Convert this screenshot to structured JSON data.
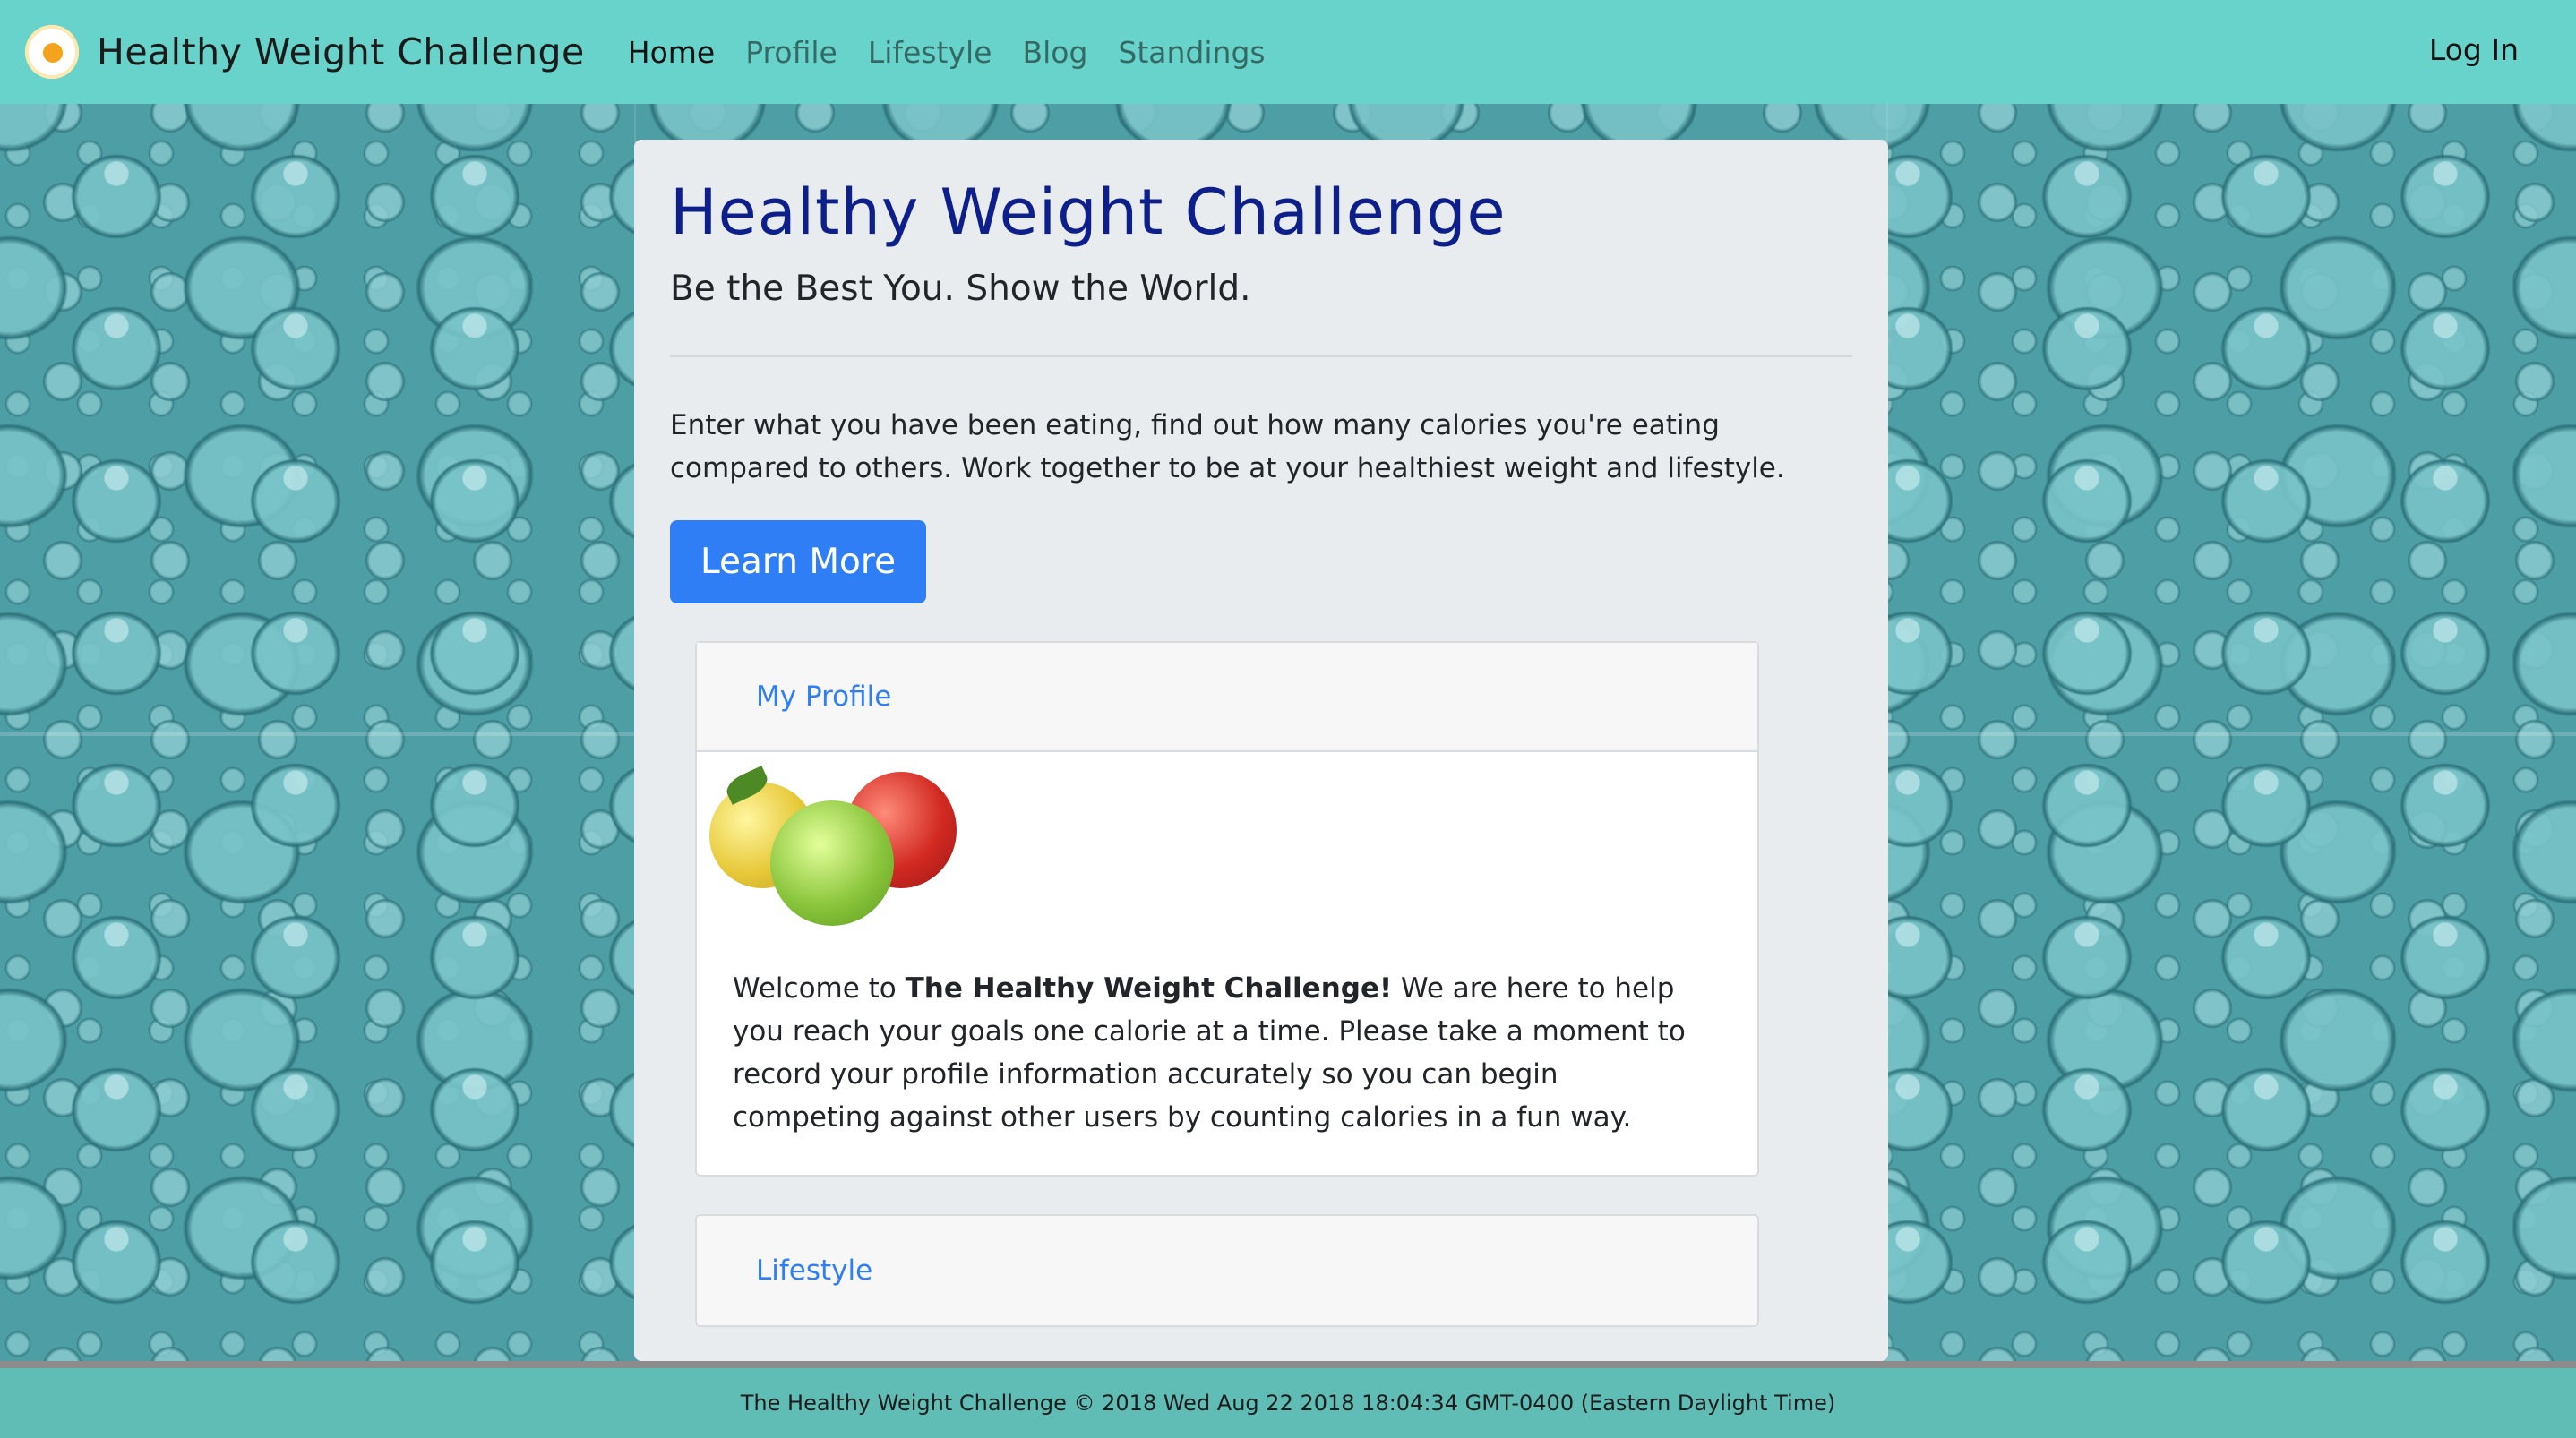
{
  "navbar": {
    "brand": "Healthy Weight Challenge",
    "links": [
      {
        "label": "Home",
        "active": true
      },
      {
        "label": "Profile",
        "active": false
      },
      {
        "label": "Lifestyle",
        "active": false
      },
      {
        "label": "Blog",
        "active": false
      },
      {
        "label": "Standings",
        "active": false
      }
    ],
    "login": "Log In"
  },
  "hero": {
    "title": "Healthy Weight Challenge",
    "subtitle": "Be the Best You. Show the World.",
    "lead": "Enter what you have been eating, find out how many calories you're eating compared to others. Work together to be at your healthiest weight and lifestyle.",
    "button": "Learn More"
  },
  "cards": [
    {
      "header": "My Profile",
      "welcome_prefix": "Welcome to ",
      "welcome_bold": "The Healthy Weight Challenge!",
      "welcome_suffix": " We are here to help you reach your goals one calorie at a time. Please take a moment to record your profile information accurately so you can begin competing against other users by counting calories in a fun way."
    },
    {
      "header": "Lifestyle"
    }
  ],
  "footer": {
    "text": "The Healthy Weight Challenge © 2018 Wed Aug 22 2018 18:04:34 GMT-0400 (Eastern Daylight Time)"
  },
  "colors": {
    "navbar": "#68d3ca",
    "title": "#0d1f8a",
    "accent": "#2f7ef6",
    "footer": "#5fbdb6"
  },
  "icons": {
    "brand": "egg-flower-icon"
  }
}
